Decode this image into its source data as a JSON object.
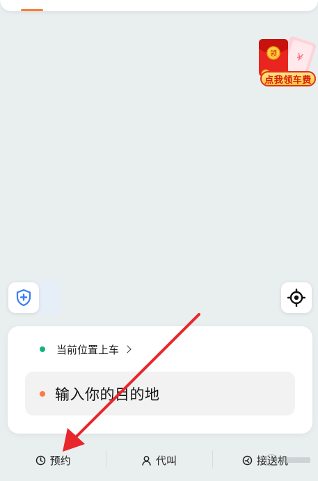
{
  "promo": {
    "badge_label": "点我领车费",
    "icon": "red-envelope-icon"
  },
  "map_controls": {
    "safety_icon": "shield-plus-icon",
    "locate_icon": "crosshair-locate-icon"
  },
  "panel": {
    "pickup_label": "当前位置上车",
    "destination_placeholder": "输入你的目的地"
  },
  "tabs": [
    {
      "label": "预约",
      "icon": "clock-icon"
    },
    {
      "label": "代叫",
      "icon": "person-icon"
    },
    {
      "label": "接送机",
      "icon": "plane-circle-icon"
    }
  ],
  "colors": {
    "accent_orange": "#ff7a3d",
    "pickup_green": "#17b27a",
    "annotation_red": "#e8262b",
    "shield_blue": "#3a7cf0"
  }
}
